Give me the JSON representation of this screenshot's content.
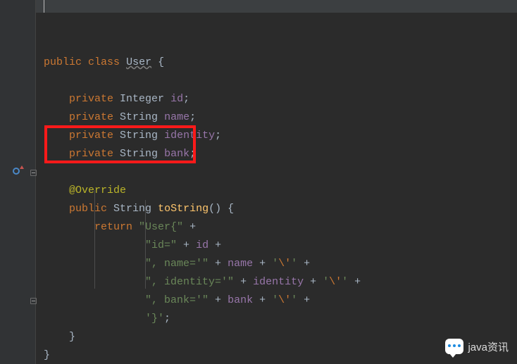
{
  "gutter": {
    "lines": [
      "",
      "",
      "",
      "",
      "",
      "",
      "",
      "",
      "",
      "",
      "",
      "",
      "",
      "",
      "",
      "",
      "",
      "",
      ""
    ]
  },
  "code": {
    "l5": {
      "kw_public": "public",
      "kw_class": "class",
      "classname": "User",
      "brace": " {"
    },
    "l7": {
      "kw_private": "private",
      "type": "Integer",
      "field": "id"
    },
    "l8": {
      "kw_private": "private",
      "type": "String",
      "field": "name"
    },
    "l9": {
      "kw_private": "private",
      "type": "String",
      "field": "identity"
    },
    "l10": {
      "kw_private": "private",
      "type": "String",
      "field": "bank"
    },
    "l12": {
      "annotation": "@Override"
    },
    "l13": {
      "kw_public": "public",
      "ret": "String",
      "method": "toString",
      "parens": "()",
      "brace": " {"
    },
    "l14": {
      "kw_return": "return",
      "str": "\"User{\"",
      "plus": " +"
    },
    "l15": {
      "str": "\"id=\"",
      "plus1": " + ",
      "var": "id",
      "plus2": " +"
    },
    "l16": {
      "str1": "\", name='\"",
      "plus1": " + ",
      "var": "name",
      "plus2": " + ",
      "q1": "'",
      "esc": "\\'",
      "q2": "'",
      "plus3": " +"
    },
    "l17": {
      "str1": "\", identity='\"",
      "plus1": " + ",
      "var": "identity",
      "plus2": " + ",
      "q1": "'",
      "esc": "\\'",
      "q2": "'",
      "plus3": " +"
    },
    "l18": {
      "str1": "\", bank='\"",
      "plus1": " + ",
      "var": "bank",
      "plus2": " + ",
      "q1": "'",
      "esc": "\\'",
      "q2": "'",
      "plus3": " +"
    },
    "l19": {
      "str": "'}'",
      "semi": ";"
    },
    "l20": {
      "brace": "}"
    },
    "l21": {
      "brace": "}"
    }
  },
  "watermark": {
    "text": "java资讯"
  }
}
